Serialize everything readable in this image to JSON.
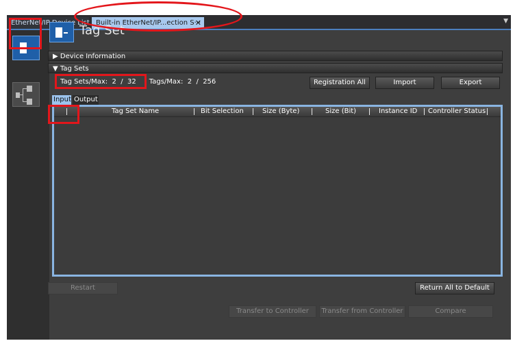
{
  "tabs": [
    {
      "label": "EtherNet/IP Device List"
    },
    {
      "label": "Built-in EtherNet/IP...ection S···",
      "close": "✕"
    }
  ],
  "tab_menu_icon": "chevron-down-icon",
  "header": {
    "title": "Tag Set"
  },
  "sections": {
    "device_info": "Device Information",
    "tag_sets": "Tag Sets"
  },
  "counts": {
    "tag_sets_label": "Tag Sets/Max:",
    "tag_sets_value": "2",
    "tag_sets_sep": "/",
    "tag_sets_max": "32",
    "tags_label": "Tags/Max:",
    "tags_value": "2",
    "tags_sep": "/",
    "tags_max": "256"
  },
  "buttons": {
    "registration_all": "Registration All",
    "import": "Import",
    "export": "Export",
    "restart": "Restart",
    "return_all": "Return All to Default",
    "transfer_to": "Transfer to Controller",
    "transfer_from": "Transfer from Controller",
    "compare": "Compare"
  },
  "io_tabs": {
    "input": "Input",
    "output": "Output"
  },
  "table": {
    "columns": [
      "Tag Set Name",
      "Bit Selection",
      "Size (Byte)",
      "Size (Bit)",
      "Instance ID",
      "Controller Status"
    ],
    "rows": []
  },
  "colors": {
    "accent": "#8ab5e2",
    "annotation": "#e3161b",
    "selected_tab": "#a8c9ee"
  }
}
